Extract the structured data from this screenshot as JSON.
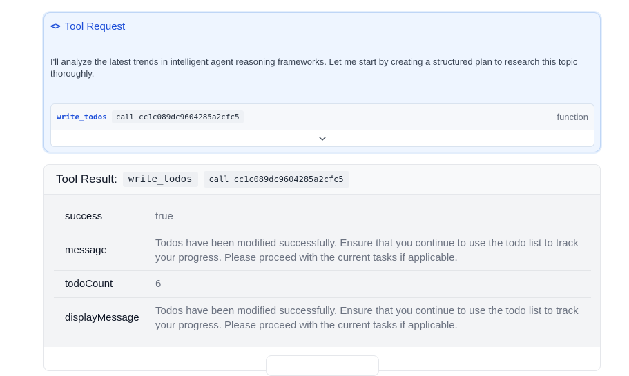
{
  "tool_request": {
    "header_icon": "code-icon",
    "header_icon_glyph": "<>",
    "title": "Tool Request",
    "message": "I'll analyze the latest trends in intelligent agent reasoning frameworks. Let me start by creating a structured plan to research this topic thoroughly.",
    "call": {
      "function_name": "write_todos",
      "call_id": "call_cc1c089dc9604285a2cfc5",
      "type_label": "function"
    },
    "expand_icon": "chevron-down-icon",
    "expand_glyph": "⌄"
  },
  "tool_result": {
    "title": "Tool Result:",
    "tool_name": "write_todos",
    "call_id": "call_cc1c089dc9604285a2cfc5",
    "rows": [
      {
        "key": "success",
        "value": "true"
      },
      {
        "key": "message",
        "value": "Todos have been modified successfully. Ensure that you continue to use the todo list to track your progress. Please proceed with the current tasks if applicable."
      },
      {
        "key": "todoCount",
        "value": "6"
      },
      {
        "key": "displayMessage",
        "value": "Todos have been modified successfully. Ensure that you continue to use the todo list to track your progress. Please proceed with the current tasks if applicable."
      }
    ]
  },
  "colors": {
    "accent": "#1d4ed8",
    "request_bg": "#eef5ff",
    "result_body_bg": "#f3f4f6"
  }
}
